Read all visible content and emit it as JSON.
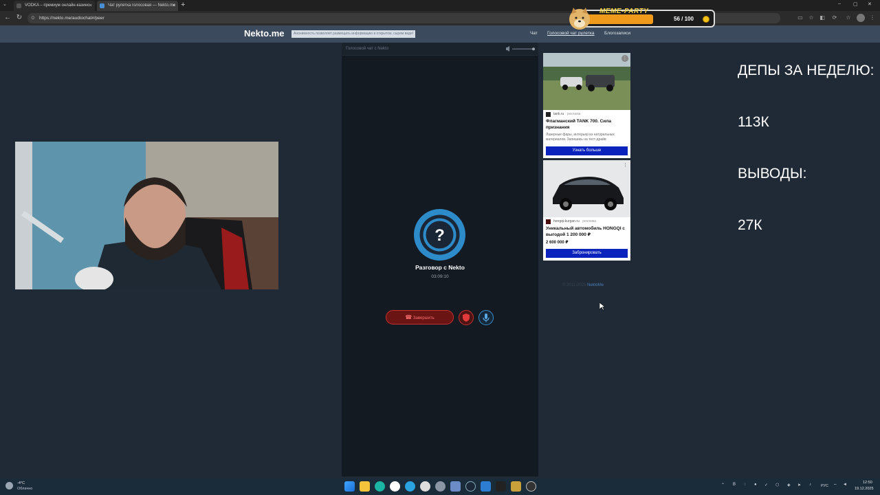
{
  "browser": {
    "tabs": [
      {
        "label": "VODKA – премиум онлайн-казино",
        "close": "×"
      },
      {
        "label": "Чат рулетка голосовая — Nekto.me",
        "close": "×"
      }
    ],
    "new_tab": "+",
    "url": "https://nekto.me/audiochat#/peer",
    "window_controls": [
      "–",
      "▢",
      "✕"
    ]
  },
  "site": {
    "logo": "Nekto.me",
    "slogan": "Анонимность позволяет размещать информацию в открытом, сырем виде!",
    "nav": [
      "Чат",
      "Голосовой чат рулетка",
      "Блогозаписи"
    ]
  },
  "chat": {
    "panel_title": "Голосовой чат с Nekto",
    "partner": "Разговор с Nekto",
    "timer": "03:09:10",
    "end_button": "Завершить",
    "avatar_glyph": "?"
  },
  "ads": [
    {
      "source": "tank.ru",
      "label": "реклама",
      "title": "Флагманский TANK 700. Сила признания",
      "description": "Лазерные фары, интерьер из натуральных материалов. Запишись на тест-драйв",
      "button": "Узнать больше"
    },
    {
      "source": "hongqi-kurgan.ru",
      "label": "реклама",
      "title": "Уникальный автомобиль HONGQI с выгодой 1 200 000 ₽",
      "price": "2 600 000 ₽",
      "button": "Забронировать"
    }
  ],
  "ad_footer": {
    "copyright": "© 2011-2025",
    "brand": "NektoMe"
  },
  "meme_party": {
    "title": "MEME-PARTY",
    "count": "56 / 100",
    "progress": 0.56
  },
  "overlay": {
    "line1": "ДЕПЫ ЗА НЕДЕЛЮ:",
    "line2": "113К",
    "line3": "ВЫВОДЫ:",
    "line4": "27К"
  },
  "taskbar": {
    "weather_temp": "-4°C",
    "weather_desc": "Облачно",
    "lang": "РУС",
    "time": "12:50",
    "date": "19.12.2025"
  },
  "colors": {
    "accent_blue": "#2e8bc9",
    "end_red": "#c93030",
    "ad_button": "#0a23bd"
  }
}
